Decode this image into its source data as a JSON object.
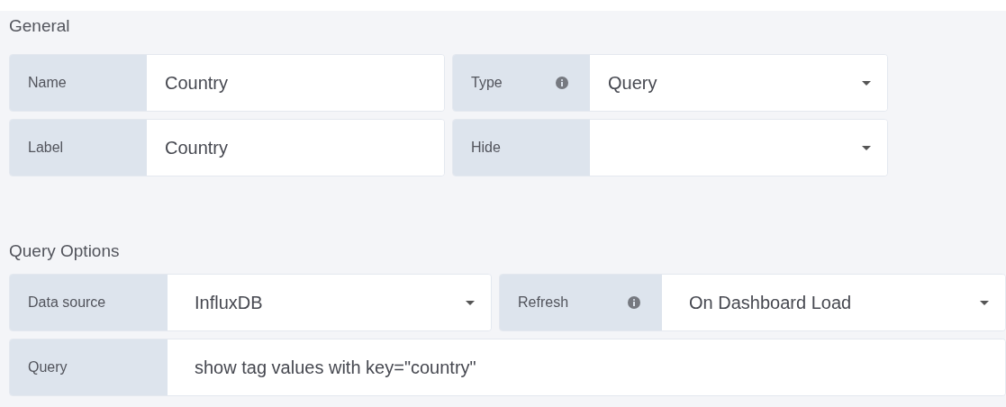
{
  "sections": [
    {
      "title": "General",
      "rows": [
        [
          {
            "label": "Name",
            "kind": "input",
            "value": "Country"
          },
          {
            "label": "Type",
            "info": true,
            "kind": "select",
            "value": "Query"
          }
        ],
        [
          {
            "label": "Label",
            "kind": "input",
            "value": "Country"
          },
          {
            "label": "Hide",
            "kind": "select"
          }
        ]
      ]
    },
    {
      "title": "Query Options",
      "rows": [
        [
          {
            "label": "Data source",
            "kind": "select",
            "value": "InfluxDB"
          },
          {
            "label": "Refresh",
            "info": true,
            "kind": "select",
            "value": "On Dashboard Load"
          }
        ],
        [
          {
            "label": "Query",
            "kind": "input",
            "value": "show tag values with key=\"country\""
          }
        ]
      ]
    }
  ]
}
